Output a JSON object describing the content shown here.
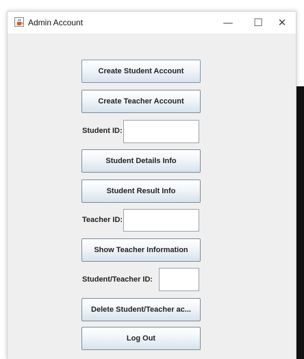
{
  "window": {
    "title": "Admin Account",
    "controls": {
      "minimize": "—",
      "maximize": "☐",
      "close": "✕"
    }
  },
  "form": {
    "create_student_button": "Create Student Account",
    "create_teacher_button": "Create Teacher Account",
    "student_id_label": "Student ID:",
    "student_id_value": "",
    "student_details_button": "Student Details Info",
    "student_result_button": "Student Result Info",
    "teacher_id_label": "Teacher ID:",
    "teacher_id_value": "",
    "show_teacher_button": "Show Teacher Information",
    "student_teacher_id_label": "Student/Teacher ID:",
    "student_teacher_id_value": "",
    "delete_button": "Delete Student/Teacher ac...",
    "logout_button": "Log Out"
  },
  "icons": {
    "app": "java-coffee-icon"
  },
  "colors": {
    "window_bg": "#efefef",
    "button_bottom": "#d7e2ec",
    "button_border": "#7a8a99"
  }
}
